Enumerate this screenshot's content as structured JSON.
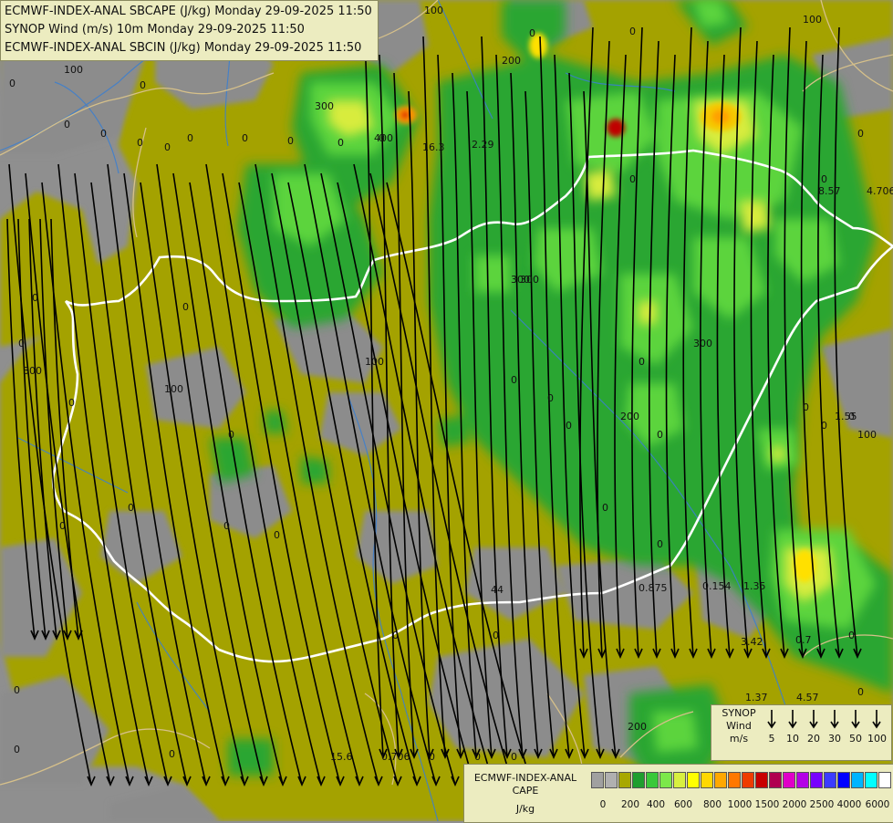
{
  "titles": {
    "line1": "ECMWF-INDEX-ANAL SBCAPE (J/kg) Monday 29-09-2025 11:50",
    "line2": "SYNOP Wind (m/s) 10m Monday 29-09-2025 11:50",
    "line3": "ECMWF-INDEX-ANAL SBCIN (J/kg) Monday 29-09-2025 11:50"
  },
  "wind_legend": {
    "label_line1": "SYNOP",
    "label_line2": "Wind",
    "label_line3": "m/s",
    "speeds": [
      "5",
      "10",
      "20",
      "30",
      "50",
      "100"
    ]
  },
  "cape_legend": {
    "label_line1": "ECMWF-INDEX-ANAL",
    "label_line2": "CAPE",
    "label_line3": "J/kg",
    "ticks": [
      "0",
      "200",
      "400",
      "600",
      "800",
      "1000",
      "1500",
      "2000",
      "2500",
      "4000",
      "6000"
    ],
    "colors": [
      "#a0a0a0",
      "#b0b0b0",
      "#a8a800",
      "#1f9e2e",
      "#39c839",
      "#7ce84a",
      "#d8f040",
      "#ffff00",
      "#ffd800",
      "#ffa800",
      "#ff7800",
      "#ee3c00",
      "#c80000",
      "#b00050",
      "#e000c8",
      "#b400e6",
      "#7800ff",
      "#3c3cff",
      "#0000ff",
      "#00b4ff",
      "#00ffff",
      "#ffffff"
    ]
  },
  "map_values": [
    {
      "text": "100"
    },
    {
      "text": "100"
    },
    {
      "text": "100"
    },
    {
      "text": "0"
    },
    {
      "text": "0"
    },
    {
      "text": "0"
    },
    {
      "text": "0"
    },
    {
      "text": "0"
    },
    {
      "text": "0"
    },
    {
      "text": "0"
    },
    {
      "text": "16.3"
    },
    {
      "text": "2.29"
    },
    {
      "text": "0"
    },
    {
      "text": "0"
    },
    {
      "text": "200"
    },
    {
      "text": "300"
    },
    {
      "text": "300"
    },
    {
      "text": "400"
    },
    {
      "text": "0"
    },
    {
      "text": "0"
    },
    {
      "text": "0"
    },
    {
      "text": "0"
    },
    {
      "text": "0"
    },
    {
      "text": "0"
    },
    {
      "text": "8.57"
    },
    {
      "text": "4.706"
    },
    {
      "text": "0"
    },
    {
      "text": "0"
    },
    {
      "text": "300"
    },
    {
      "text": "0"
    },
    {
      "text": "0"
    },
    {
      "text": "100"
    },
    {
      "text": "0"
    },
    {
      "text": "300"
    },
    {
      "text": "300"
    },
    {
      "text": "0"
    },
    {
      "text": "100"
    },
    {
      "text": "0"
    },
    {
      "text": "0"
    },
    {
      "text": "0"
    },
    {
      "text": "200"
    },
    {
      "text": "0"
    },
    {
      "text": "1.55"
    },
    {
      "text": "0"
    },
    {
      "text": "100"
    },
    {
      "text": "0"
    },
    {
      "text": "0"
    },
    {
      "text": "0"
    },
    {
      "text": "0"
    },
    {
      "text": "0"
    },
    {
      "text": "0.875"
    },
    {
      "text": "0.154"
    },
    {
      "text": "1.35"
    },
    {
      "text": "44"
    },
    {
      "text": "0"
    },
    {
      "text": "0"
    },
    {
      "text": "3.42"
    },
    {
      "text": "0.7"
    },
    {
      "text": "0"
    },
    {
      "text": "1.37"
    },
    {
      "text": "4.57"
    },
    {
      "text": "0"
    },
    {
      "text": "0"
    },
    {
      "text": "0"
    },
    {
      "text": "0"
    },
    {
      "text": "0"
    },
    {
      "text": "15.6"
    },
    {
      "text": "0.706"
    },
    {
      "text": "0"
    },
    {
      "text": "0"
    },
    {
      "text": "0"
    },
    {
      "text": "200"
    },
    {
      "text": "0"
    },
    {
      "text": "0"
    },
    {
      "text": "0"
    }
  ]
}
